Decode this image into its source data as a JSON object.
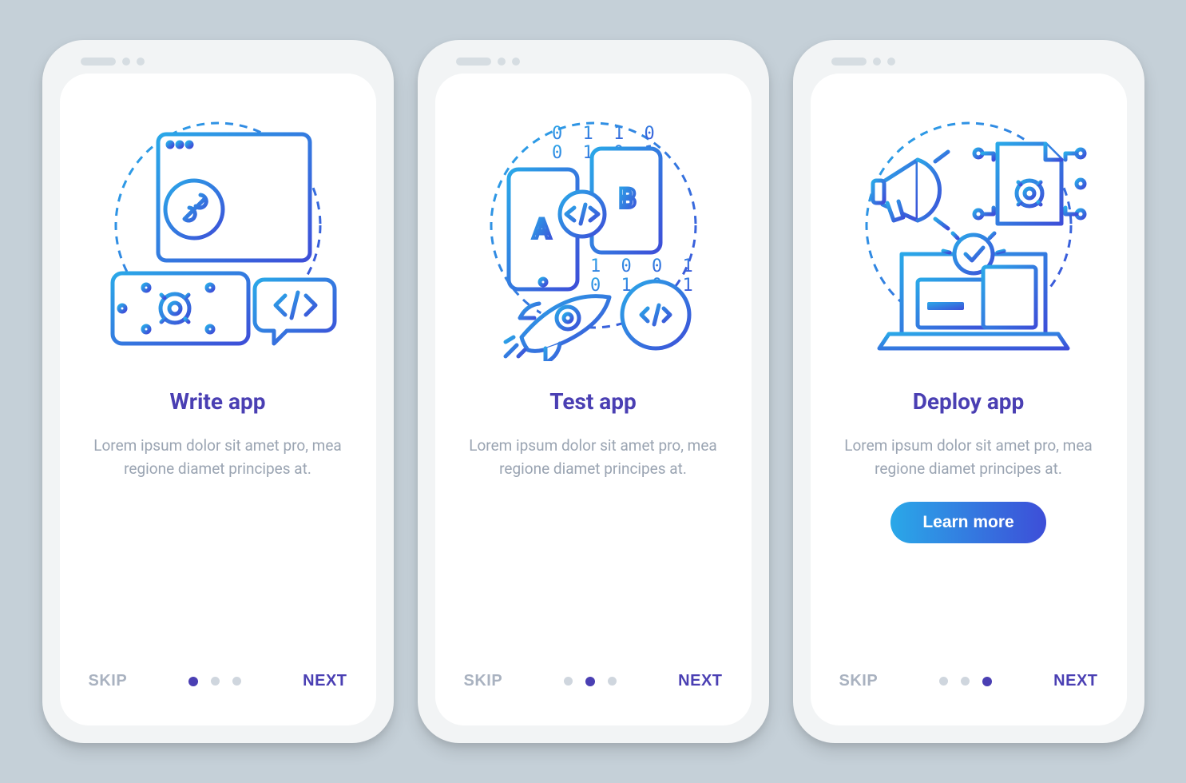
{
  "screens": [
    {
      "title": "Write app",
      "body": "Lorem ipsum dolor sit amet pro, mea regione diamet principes at.",
      "skip": "SKIP",
      "next": "NEXT",
      "activeDot": 0,
      "cta": null
    },
    {
      "title": "Test app",
      "body": "Lorem ipsum dolor sit amet pro, mea regione diamet principes at.",
      "skip": "SKIP",
      "next": "NEXT",
      "activeDot": 1,
      "cta": null
    },
    {
      "title": "Deploy app",
      "body": "Lorem ipsum dolor sit amet pro, mea regione diamet principes at.",
      "skip": "SKIP",
      "next": "NEXT",
      "activeDot": 2,
      "cta": "Learn more"
    }
  ],
  "colors": {
    "accentStart": "#2aa8e8",
    "accentEnd": "#3d4ed8",
    "title": "#4a3fb3",
    "body": "#9aa4b2"
  },
  "illustrationBinary": {
    "row1": "0  1  1  0",
    "row2": "0  1  0  1",
    "row3": "1  0  0  1",
    "row4": "0  1  0  1"
  }
}
